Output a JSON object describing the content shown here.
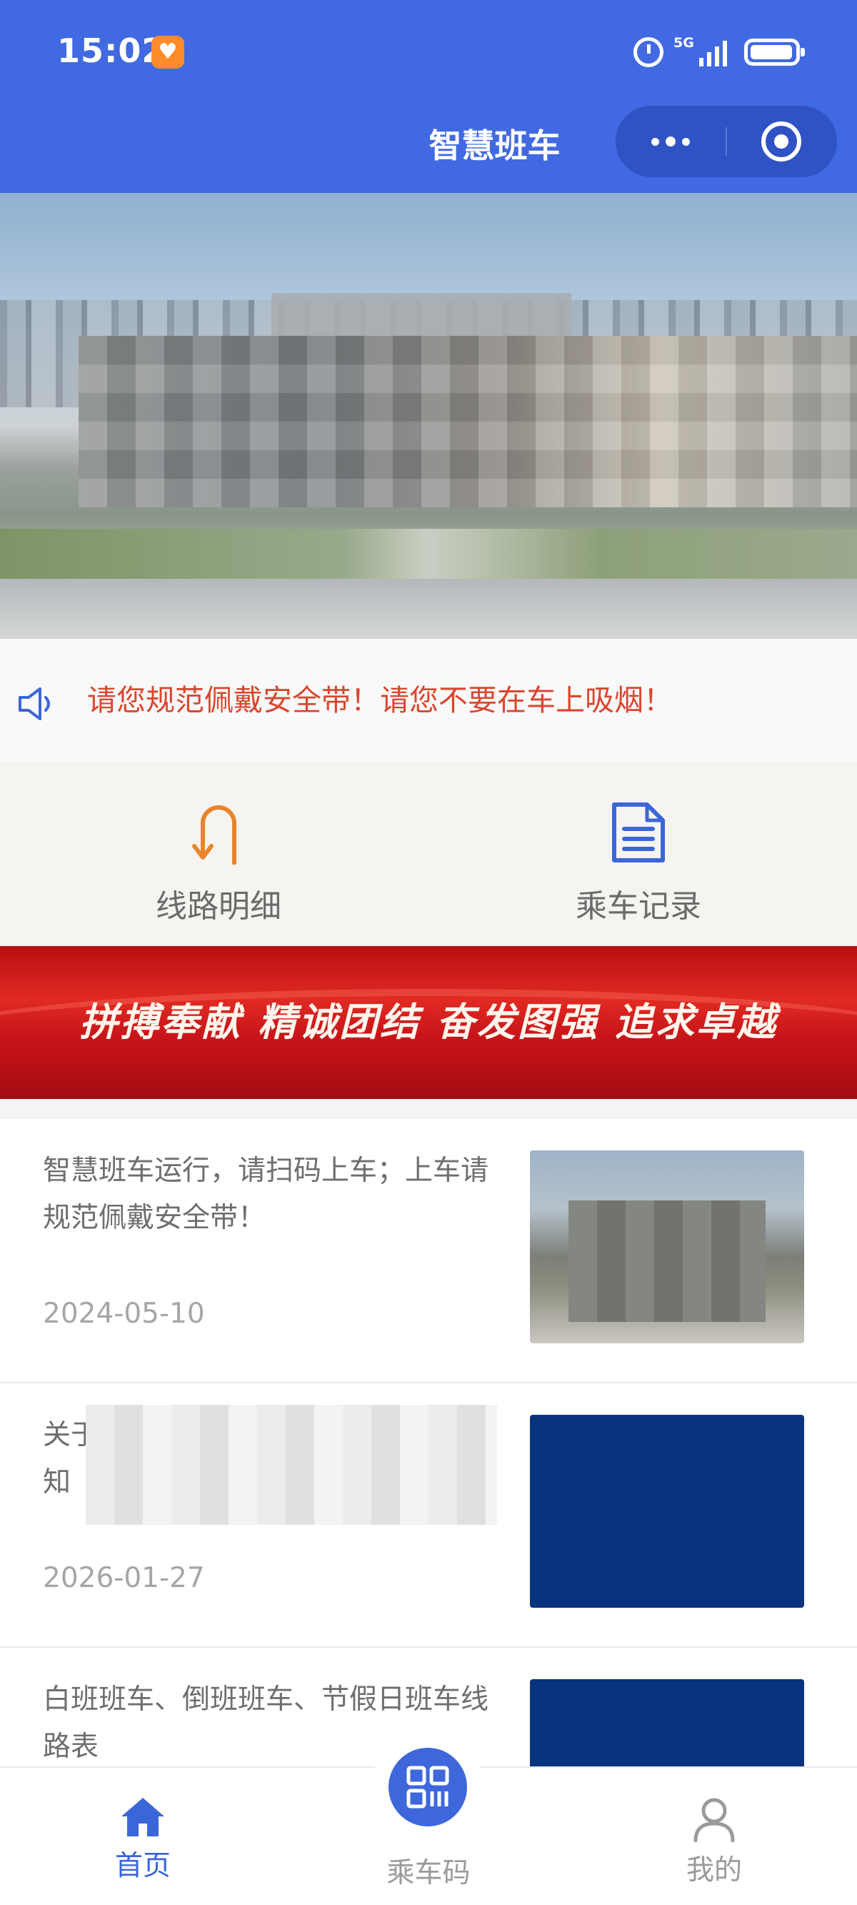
{
  "status_bar": {
    "time": "15:02",
    "network": "5G"
  },
  "header": {
    "title": "智慧班车"
  },
  "notice": {
    "text": "请您规范佩戴安全带！请您不要在车上吸烟！"
  },
  "quick_nav": [
    {
      "label": "线路明细",
      "icon": "u-turn-arrow-icon"
    },
    {
      "label": "乘车记录",
      "icon": "document-icon"
    }
  ],
  "slogan": {
    "text": "拼搏奉献 精诚团结 奋发图强 追求卓越"
  },
  "news": [
    {
      "title": "智慧班车运行，请扫码上车；上车请规范佩戴安全带！",
      "date": "2024-05-10"
    },
    {
      "title": "关于",
      "title_line2": "知",
      "date": "2026-01-27"
    },
    {
      "title": "白班班车、倒班班车、节假日班车线路表"
    }
  ],
  "tabbar": [
    {
      "label": "首页",
      "icon": "home-icon",
      "active": true
    },
    {
      "label": "乘车码",
      "icon": "qr-code-icon",
      "active": false
    },
    {
      "label": "我的",
      "icon": "user-icon",
      "active": false
    }
  ],
  "colors": {
    "primary": "#4169e1",
    "notice_text": "#d9472f",
    "nav_orange": "#e8852a",
    "nav_blue": "#3b66d9"
  }
}
